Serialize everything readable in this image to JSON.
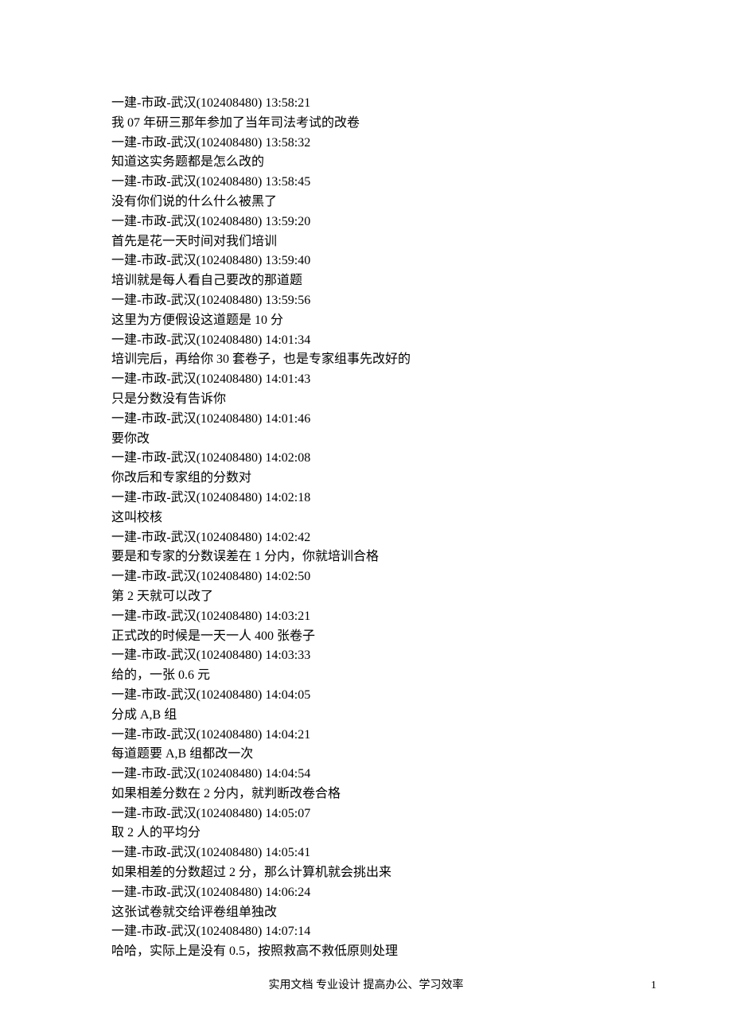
{
  "messages": [
    {
      "header": "一建-市政-武汉(102408480) 13:58:21",
      "body": "我 07 年研三那年参加了当年司法考试的改卷"
    },
    {
      "header": "一建-市政-武汉(102408480) 13:58:32",
      "body": "知道这实务题都是怎么改的"
    },
    {
      "header": "一建-市政-武汉(102408480) 13:58:45",
      "body": "没有你们说的什么什么被黑了"
    },
    {
      "header": "一建-市政-武汉(102408480) 13:59:20",
      "body": "首先是花一天时间对我们培训"
    },
    {
      "header": "一建-市政-武汉(102408480) 13:59:40",
      "body": "培训就是每人看自己要改的那道题"
    },
    {
      "header": "一建-市政-武汉(102408480) 13:59:56",
      "body": "这里为方便假设这道题是 10 分"
    },
    {
      "header": "一建-市政-武汉(102408480) 14:01:34",
      "body": "培训完后，再给你 30 套卷子，也是专家组事先改好的"
    },
    {
      "header": "一建-市政-武汉(102408480) 14:01:43",
      "body": "只是分数没有告诉你"
    },
    {
      "header": "一建-市政-武汉(102408480) 14:01:46",
      "body": "要你改"
    },
    {
      "header": "一建-市政-武汉(102408480) 14:02:08",
      "body": "你改后和专家组的分数对"
    },
    {
      "header": "一建-市政-武汉(102408480) 14:02:18",
      "body": "这叫校核"
    },
    {
      "header": "一建-市政-武汉(102408480) 14:02:42",
      "body": "要是和专家的分数误差在 1 分内，你就培训合格"
    },
    {
      "header": "一建-市政-武汉(102408480) 14:02:50",
      "body": "第 2 天就可以改了"
    },
    {
      "header": "一建-市政-武汉(102408480) 14:03:21",
      "body": "正式改的时候是一天一人 400 张卷子"
    },
    {
      "header": "一建-市政-武汉(102408480) 14:03:33",
      "body": "给的，一张 0.6 元"
    },
    {
      "header": "一建-市政-武汉(102408480) 14:04:05",
      "body": "分成 A,B 组"
    },
    {
      "header": "一建-市政-武汉(102408480) 14:04:21",
      "body": "每道题要 A,B 组都改一次"
    },
    {
      "header": "一建-市政-武汉(102408480) 14:04:54",
      "body": "如果相差分数在 2 分内，就判断改卷合格"
    },
    {
      "header": "一建-市政-武汉(102408480) 14:05:07",
      "body": "取 2 人的平均分"
    },
    {
      "header": "一建-市政-武汉(102408480) 14:05:41",
      "body": "如果相差的分数超过 2 分，那么计算机就会挑出来"
    },
    {
      "header": "一建-市政-武汉(102408480) 14:06:24",
      "body": "这张试卷就交给评卷组单独改"
    },
    {
      "header": "一建-市政-武汉(102408480) 14:07:14",
      "body": "哈哈，实际上是没有 0.5，按照救高不救低原则处理"
    }
  ],
  "footer_text": "实用文档 专业设计 提高办公、学习效率",
  "page_number": "1"
}
